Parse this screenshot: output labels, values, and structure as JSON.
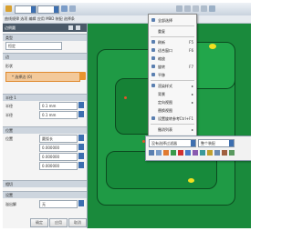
{
  "window": {
    "title": "曲线规律 选项 编辑 应用 MBD 装配 选择条"
  },
  "panel": {
    "header": "边倒圆",
    "sections": {
      "type": "类型",
      "edge": "边",
      "shape": "形状",
      "radius": "半径 1",
      "position": "位置",
      "tangency": "相切",
      "settings": "设置"
    },
    "type_value": "恒定",
    "edge_select": "* 选择边 (0)",
    "radius_label": "半径",
    "radius_value": "0.1 mm",
    "radius2_value": "0.1 mm",
    "fields": [
      {
        "label": "位置",
        "value": "圆弧长"
      },
      {
        "label": "",
        "value": "0.000000"
      },
      {
        "label": "",
        "value": "0.000000"
      },
      {
        "label": "",
        "value": "0.000000"
      }
    ],
    "setting_label": "溢出解",
    "setting_value": "无",
    "ok_label": "确定",
    "apply_label": "应用",
    "cancel_label": "取消"
  },
  "context_menu": {
    "items": [
      {
        "label": "全部选择",
        "shortcut": ""
      },
      {
        "label": "重复",
        "shortcut": ""
      },
      {
        "label": "刷新",
        "shortcut": "F5"
      },
      {
        "label": "适合窗口",
        "shortcut": "F6"
      },
      {
        "label": "缩放",
        "shortcut": ""
      },
      {
        "label": "旋转",
        "shortcut": "F7"
      },
      {
        "label": "平移",
        "shortcut": ""
      },
      {
        "label": "渲染样式",
        "shortcut": ""
      },
      {
        "label": "背景",
        "shortcut": ""
      },
      {
        "label": "定向视图",
        "shortcut": ""
      },
      {
        "label": "替换视图",
        "shortcut": ""
      },
      {
        "label": "设置旋转参考",
        "shortcut": "Ctrl+F1"
      },
      {
        "label": "撤消列表",
        "shortcut": ""
      }
    ]
  },
  "select_bar": {
    "filter_value": "没有选择过滤器",
    "scope_value": "整个装配"
  },
  "colors": {
    "viewport_green": "#1a8a3c",
    "accent_blue": "#3d6fb0",
    "selection_orange": "#f3c99a"
  }
}
